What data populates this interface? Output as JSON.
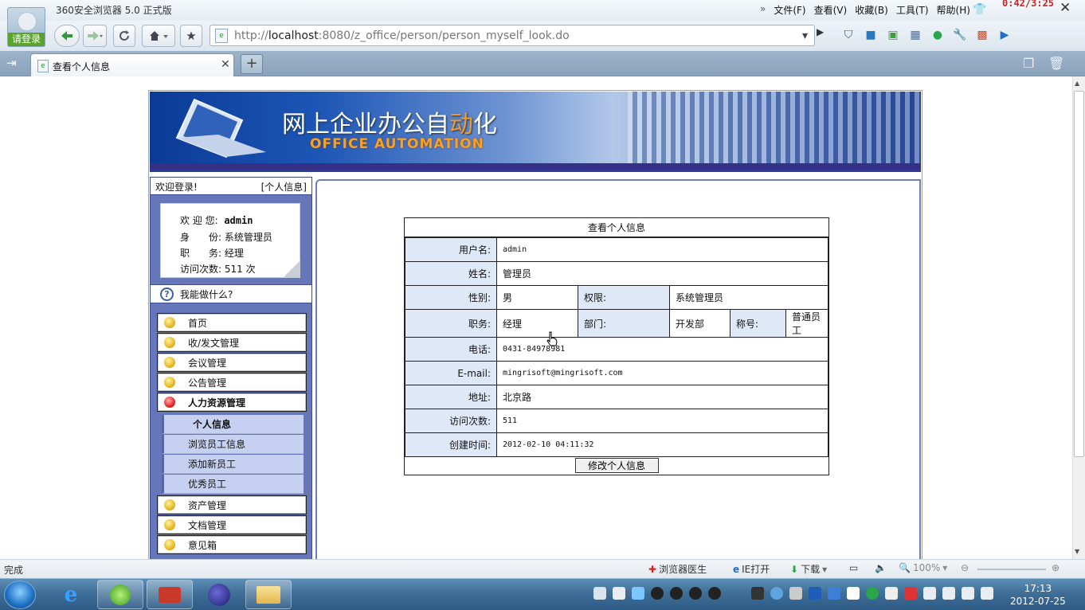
{
  "browser": {
    "title": "360安全浏览器 5.0 正式版",
    "login_label": "请登录",
    "menus": [
      "文件(F)",
      "查看(V)",
      "收藏(B)",
      "工具(T)",
      "帮助(H)"
    ],
    "menu_overflow": "»",
    "timer": "0:42/3:25",
    "address": {
      "prefix": "http://",
      "host": "localhost",
      "rest": ":8080/z_office/person/person_myself_look.do"
    },
    "tab_title": "查看个人信息",
    "new_tab": "+",
    "accent": "#5aa32c"
  },
  "page": {
    "banner": {
      "title_a": "网上企业办公自",
      "title_hl": "动",
      "title_b": "化",
      "subtitle": "OFFICE AUTOMATION"
    },
    "sidebar": {
      "welcome": "欢迎登录!",
      "personal_link": "[个人信息]",
      "user": {
        "greet_label": "欢 迎 您:",
        "greet_value": "admin",
        "role_label": "身　　份:",
        "role_value": "系统管理员",
        "job_label": "职　　务:",
        "job_value": "经理",
        "visits_label": "访问次数:",
        "visits_value": "511 次"
      },
      "help": "我能做什么?",
      "menu_top": [
        "首页",
        "收/发文管理",
        "会议管理",
        "公告管理",
        "人力资源管理"
      ],
      "submenu": [
        "个人信息",
        "浏览员工信息",
        "添加新员工",
        "优秀员工"
      ],
      "menu_bottom": [
        "资产管理",
        "文档管理",
        "意见箱"
      ]
    },
    "form": {
      "heading": "查看个人信息",
      "username_label": "用户名:",
      "username": "admin",
      "name_label": "姓名:",
      "name": "管理员",
      "gender_label": "性别:",
      "gender": "男",
      "perm_label": "权限:",
      "perm": "系统管理员",
      "job_label": "职务:",
      "job": "经理",
      "dept_label": "部门:",
      "dept": "开发部",
      "title_label": "称号:",
      "title": "普通员工",
      "phone_label": "电话:",
      "phone": "0431-84978981",
      "email_label": "E-mail:",
      "email": "mingrisoft@mingrisoft.com",
      "addr_label": "地址:",
      "addr": "北京路",
      "visits_label": "访问次数:",
      "visits": "511",
      "created_label": "创建时间:",
      "created": "2012-02-10 04:11:32",
      "edit_button": "修改个人信息"
    }
  },
  "status": {
    "done": "完成",
    "doctor": "浏览器医生",
    "ie_open": "IE打开",
    "download": "下载",
    "zoom": "100%"
  },
  "taskbar": {
    "time": "17:13",
    "date": "2012-07-25"
  }
}
